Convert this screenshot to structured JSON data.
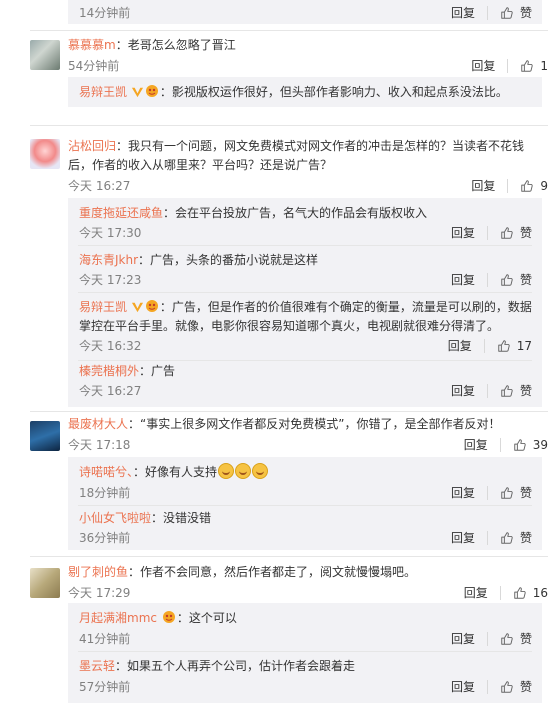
{
  "ops": {
    "reply": "回复",
    "like": "赞"
  },
  "top_sub": {
    "time": "14分钟前",
    "likes": "赞"
  },
  "c1": {
    "name": "慕慕慕m",
    "text": "：老哥怎么忽略了晋江",
    "time": "54分钟前",
    "likes": "1",
    "subs": [
      {
        "name": "易辩王凯",
        "text": "：影视版权运作很好，但头部作者影响力、收入和起点系没法比。"
      }
    ]
  },
  "c2": {
    "name": "沾松回归",
    "text": "：我只有一个问题，网文免费模式对网文作者的冲击是怎样的？当读者不花钱后，作者的收入从哪里来？平台吗？还是说广告？",
    "time": "今天 16:27",
    "likes": "9",
    "subs": [
      {
        "name": "重度拖延还咸鱼",
        "text": "：会在平台投放广告，名气大的作品会有版权收入",
        "time": "今天 17:30",
        "likes": "赞"
      },
      {
        "name": "海东青Jkhr",
        "text": "：广告，头条的番茄小说就是这样",
        "time": "今天 17:23",
        "likes": "赞"
      },
      {
        "name": "易辩王凯",
        "text": "：广告，但是作者的价值很难有个确定的衡量，流量是可以刷的，数据掌控在平台手里。就像，电影你很容易知道哪个真火，电视剧就很难分得清了。",
        "time": "今天 16:32",
        "likes": "17"
      },
      {
        "name": "榛莞楷桐外",
        "text": "：广告",
        "time": "今天 16:27",
        "likes": "赞"
      }
    ]
  },
  "c3": {
    "name": "最废材大人",
    "text": "：“事实上很多网文作者都反对免费模式”，你错了，是全部作者反对！",
    "time": "今天 17:18",
    "likes": "39",
    "subs": [
      {
        "name": "诗喏喏兮、",
        "text": "：好像有人支持",
        "time": "18分钟前",
        "likes": "赞"
      },
      {
        "name": "小仙女飞啦啦",
        "text": "：没错没错",
        "time": "36分钟前",
        "likes": "赞"
      }
    ]
  },
  "c4": {
    "name": "剔了刺的鱼",
    "text": "：作者不会同意，然后作者都走了，阅文就慢慢塌吧。",
    "time": "今天 17:29",
    "likes": "16",
    "subs": [
      {
        "name": "月起满湘mmc",
        "text": "：这个可以",
        "time": "41分钟前",
        "likes": "赞"
      },
      {
        "name": "墨云轻",
        "text": "：如果五个人再弄个公司，估计作者会跟着走",
        "time": "57分钟前",
        "likes": "赞"
      }
    ]
  }
}
